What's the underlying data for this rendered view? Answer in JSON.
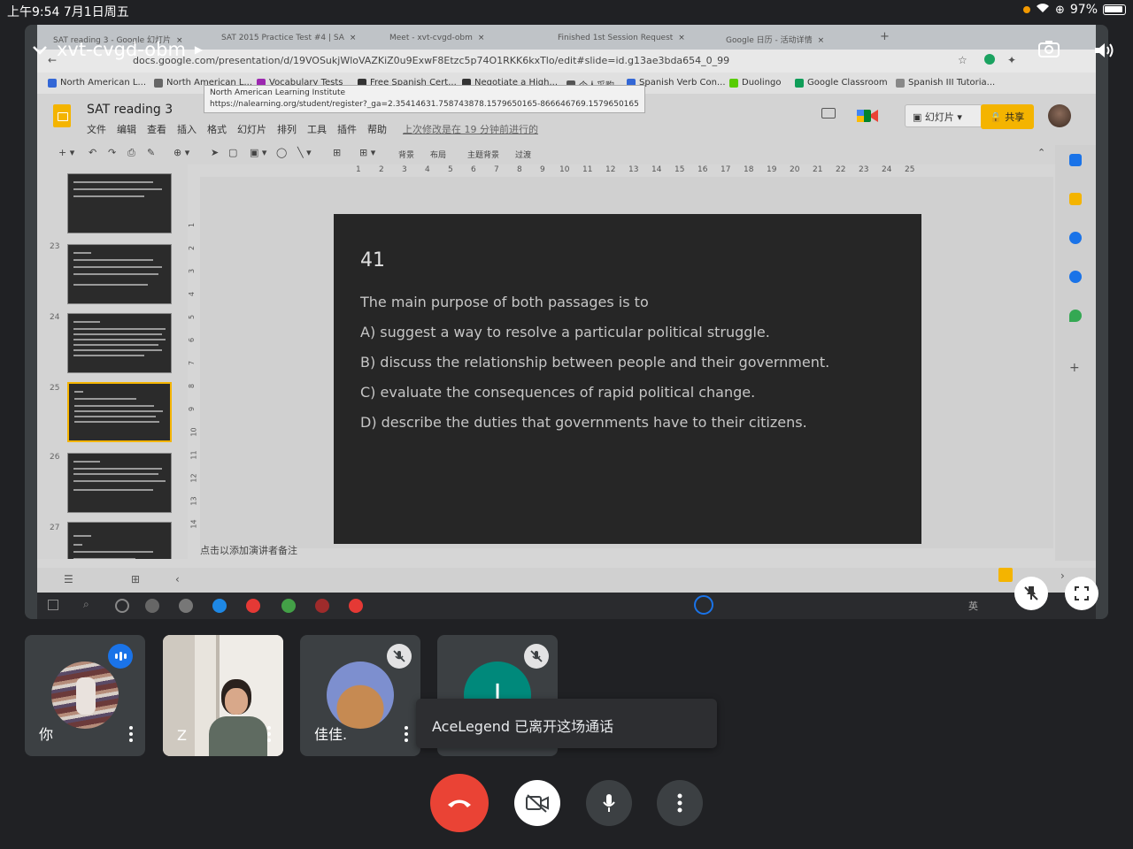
{
  "status_bar": {
    "time_date": "上午9:54   7月1日周五",
    "battery": "97%"
  },
  "meeting": {
    "code": "xvt-cvgd-obm"
  },
  "browser": {
    "tabs": [
      {
        "label": "SAT reading 3 - Google 幻灯片"
      },
      {
        "label": "SAT 2015 Practice Test #4 | SA"
      },
      {
        "label": "Meet - xvt-cvgd-obm"
      },
      {
        "label": "Finished 1st Session Request"
      },
      {
        "label": "Google 日历 - 活动详情"
      }
    ],
    "url": "docs.google.com/presentation/d/19VOSukjWloVAZKiZ0u9ExwF8Etzc5p74O1RKK6kxTlo/edit#slide=id.g13ae3bda654_0_99",
    "bookmarks": [
      {
        "label": "North American L...",
        "color": "#3367d6"
      },
      {
        "label": "North American L...",
        "color": "#666666"
      },
      {
        "label": "Vocabulary Tests",
        "color": "#9c27b0"
      },
      {
        "label": "Free Spanish Cert...",
        "color": "#333333"
      },
      {
        "label": "Negotiate a High...",
        "color": "#333333"
      },
      {
        "label": "个人采购",
        "color": "#555555"
      },
      {
        "label": "Spanish Verb Con...",
        "color": "#3367d6"
      },
      {
        "label": "Duolingo",
        "color": "#58cc02"
      },
      {
        "label": "Google Classroom",
        "color": "#0f9d58"
      },
      {
        "label": "Spanish III Tutoria...",
        "color": "#888888"
      }
    ],
    "tooltip": {
      "title": "North American Learning Institute",
      "url": "https://nalearning.org/student/register?_ga=2.35414631.758743878.1579650165-866646769.1579650165"
    }
  },
  "slides_app": {
    "doc_title": "SAT reading 3",
    "menu": [
      "文件",
      "编辑",
      "查看",
      "插入",
      "格式",
      "幻灯片",
      "排列",
      "工具",
      "插件",
      "帮助"
    ],
    "last_edit": "上次修改是在 19 分钟前进行的",
    "slideshow_label": "幻灯片",
    "share_label": "共享",
    "toolbar": {
      "background": "背景",
      "layout": "布局",
      "theme": "主题背景",
      "transition": "过渡"
    },
    "ruler": [
      "1",
      "2",
      "3",
      "4",
      "5",
      "6",
      "7",
      "8",
      "9",
      "10",
      "11",
      "12",
      "13",
      "14",
      "15",
      "16",
      "17",
      "18",
      "19",
      "20",
      "21",
      "22",
      "23",
      "24",
      "25"
    ],
    "vruler": [
      "1",
      "2",
      "3",
      "4",
      "5",
      "6",
      "7",
      "8",
      "9",
      "10",
      "11",
      "12",
      "13",
      "14"
    ],
    "thumbnails": [
      "23",
      "24",
      "25",
      "26",
      "27"
    ],
    "speaker_notes": "点击以添加演讲者备注"
  },
  "slide": {
    "number": "41",
    "lines": [
      "The main purpose of both passages is to",
      "A) suggest a way to resolve a particular political struggle.",
      "B) discuss the relationship between people and their government.",
      "C) evaluate the consequences of rapid political change.",
      "D) describe the duties that governments have to their citizens."
    ]
  },
  "taskbar": {
    "lang": "英"
  },
  "participants": [
    {
      "name": "你",
      "state": "speaking"
    },
    {
      "name": "Z",
      "state": "video"
    },
    {
      "name": "佳佳.",
      "state": "muted"
    },
    {
      "name": "",
      "initial": "I",
      "state": "muted"
    }
  ],
  "toast": "AceLegend 已离开这场通话",
  "colors": {
    "hangup": "#ea4335",
    "speaking": "#1a73e8",
    "avatar_teal": "#00897b",
    "share": "#f4b400"
  }
}
